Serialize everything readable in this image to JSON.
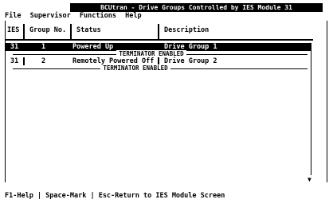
{
  "title": "BCUtran - Drive Groups Controlled by IES Module 31",
  "menu": [
    "File",
    "Supervisor",
    "Functions",
    "Help"
  ],
  "columns": [
    "IES",
    "Group No.",
    "Status",
    "Description"
  ],
  "rows": [
    {
      "ies": "31",
      "group": "1",
      "status": "Powered Up",
      "description": "Drive Group 1",
      "note": "TERMINATOR ENABLED",
      "selected": true
    },
    {
      "ies": "31",
      "group": "2",
      "status": "Remotely Powered Off",
      "description": "Drive Group 2",
      "note": "TERMINATOR ENABLED",
      "selected": false
    }
  ],
  "scroll": {
    "up": "▲",
    "down": "▼"
  },
  "status_bar": "F1-Help | Space-Mark | Esc-Return to IES Module Screen"
}
